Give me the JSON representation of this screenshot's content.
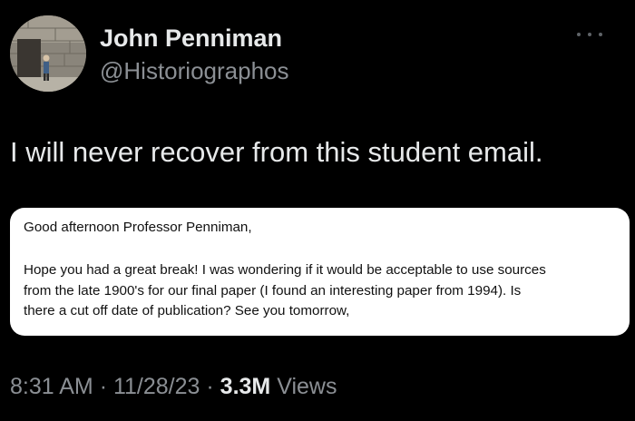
{
  "author": {
    "name": "John Penniman",
    "handle": "@Historiographos"
  },
  "tweet": {
    "text": "I will never recover from this student email."
  },
  "email": {
    "greeting": "Good afternoon Professor Penniman,",
    "body_lines": [
      "Hope you had a great break! I was wondering if it would be acceptable to use sources",
      "from the late 1900's for our final paper (I found an interesting paper from 1994). Is",
      "there a cut off date of publication? See you tomorrow,"
    ]
  },
  "meta": {
    "time": "8:31 AM",
    "separator": "·",
    "date": "11/28/23",
    "views_count": "3.3M",
    "views_label": "Views"
  },
  "icons": {
    "more": "more-horizontal-icon",
    "avatar": "profile-photo"
  }
}
